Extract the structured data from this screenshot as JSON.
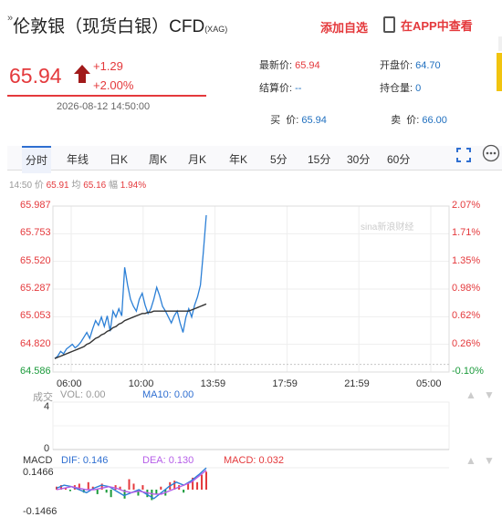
{
  "header": {
    "title": "伦敦银（现货白银）CFD",
    "title_suffix": "(XAG)",
    "add_favorite": "添加自选",
    "app_link": "在APP中查看"
  },
  "quote": {
    "price": "65.94",
    "change": "+1.29",
    "change_pct": "+2.00%",
    "datetime": "2026-08-12 14:50:00",
    "latest_label": "最新价:",
    "latest_value": "65.94",
    "open_label": "开盘价:",
    "open_value": "64.70",
    "settle_label": "结算价:",
    "settle_value": "--",
    "oi_label": "持仓量:",
    "oi_value": "0",
    "bid_label": "买  价:",
    "bid_value": "65.94",
    "ask_label": "卖  价:",
    "ask_value": "66.00"
  },
  "tabs": [
    "分时",
    "年线",
    "日K",
    "周K",
    "月K",
    "年K",
    "5分",
    "15分",
    "30分",
    "60分"
  ],
  "active_tab": "分时",
  "info": {
    "time": "14:50",
    "price_label": "价",
    "price_value": "65.91",
    "avg_label": "均",
    "avg_value": "65.16",
    "amp_label": "幅",
    "amp_value": "1.94%"
  },
  "watermark": "sina新浪财经",
  "volume": {
    "label": "成交",
    "vol_label": "VOL: 0.00",
    "ma_label": "MA10: 0.00",
    "y_top": "4",
    "y_bottom": "0"
  },
  "macd": {
    "label": "MACD",
    "dif": "DIF: 0.146",
    "dea": "DEA: 0.130",
    "macd": "MACD: 0.032",
    "y_top": "0.1466",
    "y_bottom": "-0.1466"
  },
  "colors": {
    "up": "#e4393c",
    "price_line": "#2b7fd6",
    "avg_line": "#333333",
    "accent": "#2f6fd1",
    "down_green": "#1a9a3a"
  },
  "chart_data": [
    {
      "type": "line",
      "title": "",
      "xlabel": "",
      "ylabel": "",
      "x_ticks": [
        "06:00",
        "10:00",
        "13:59",
        "17:59",
        "21:59",
        "05:00"
      ],
      "y_ticks": [
        "65.987",
        "65.753",
        "65.520",
        "65.287",
        "65.053",
        "64.820",
        "64.586"
      ],
      "y_pct_ticks": [
        "2.07%",
        "1.71%",
        "1.35%",
        "0.98%",
        "0.62%",
        "0.26%",
        "-0.10%"
      ],
      "ylim": [
        64.586,
        65.987
      ],
      "reference": 64.65,
      "series": [
        {
          "color": "#2b7fd6",
          "values": [
            64.7,
            64.72,
            64.76,
            64.74,
            64.78,
            64.8,
            64.82,
            64.79,
            64.81,
            64.84,
            64.88,
            64.92,
            64.87,
            64.95,
            65.02,
            64.98,
            65.05,
            64.97,
            65.06,
            64.93,
            65.1,
            65.05,
            65.12,
            65.06,
            65.47,
            65.32,
            65.2,
            65.14,
            65.1,
            65.2,
            65.25,
            65.15,
            65.08,
            65.12,
            65.2,
            65.3,
            65.23,
            65.14,
            65.1,
            65.05,
            65.0,
            65.06,
            65.1,
            65.0,
            64.92,
            65.05,
            65.12,
            65.05,
            65.15,
            65.22,
            65.32,
            65.6,
            65.91
          ]
        },
        {
          "color": "#333333",
          "values": [
            64.7,
            64.71,
            64.72,
            64.73,
            64.74,
            64.75,
            64.76,
            64.77,
            64.78,
            64.79,
            64.8,
            64.82,
            64.83,
            64.85,
            64.87,
            64.88,
            64.9,
            64.91,
            64.93,
            64.94,
            64.96,
            64.97,
            64.99,
            65.0,
            65.02,
            65.03,
            65.04,
            65.05,
            65.06,
            65.07,
            65.08,
            65.08,
            65.09,
            65.09,
            65.1,
            65.1,
            65.1,
            65.1,
            65.1,
            65.1,
            65.1,
            65.1,
            65.1,
            65.1,
            65.1,
            65.1,
            65.1,
            65.11,
            65.12,
            65.13,
            65.14,
            65.15,
            65.16
          ]
        }
      ]
    },
    {
      "type": "bar",
      "title": "MACD",
      "values": [
        0.02,
        0.03,
        0.01,
        -0.01,
        0.03,
        0.04,
        -0.02,
        0.05,
        0.02,
        -0.03,
        0.04,
        -0.02,
        -0.05,
        0.03,
        0.02,
        -0.06,
        0.07,
        0.04,
        -0.04,
        0.03,
        -0.05,
        -0.07,
        -0.03,
        0.02,
        -0.04,
        0.05,
        0.06,
        0.03,
        -0.02,
        0.04,
        0.08,
        0.05,
        0.1,
        0.12
      ],
      "series": [
        {
          "name": "DIF",
          "values": [
            0.01,
            0.03,
            0.02,
            0.0,
            -0.02,
            0.01,
            0.03,
            0.02,
            -0.01,
            -0.04,
            -0.02,
            0.0,
            -0.03,
            -0.06,
            -0.02,
            0.02,
            0.05,
            0.03,
            0.06,
            0.1,
            0.146
          ]
        },
        {
          "name": "DEA",
          "values": [
            0.0,
            0.01,
            0.02,
            0.01,
            0.0,
            0.0,
            0.01,
            0.02,
            0.01,
            -0.01,
            -0.02,
            -0.01,
            -0.02,
            -0.03,
            -0.03,
            -0.01,
            0.01,
            0.03,
            0.05,
            0.09,
            0.13
          ]
        }
      ]
    }
  ]
}
